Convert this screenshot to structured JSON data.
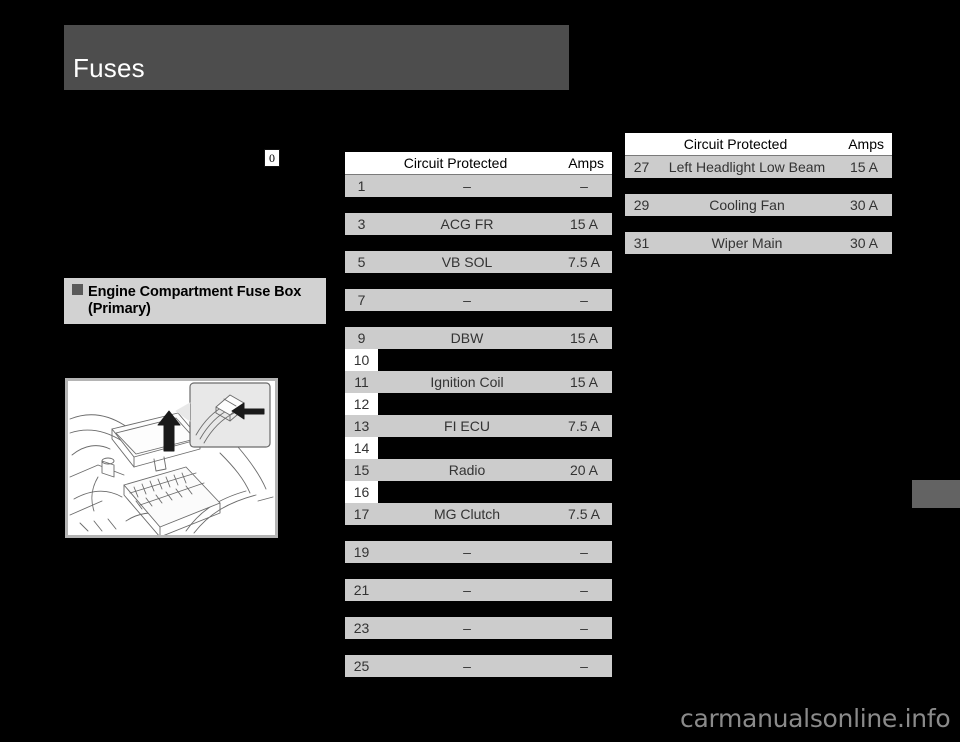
{
  "page": {
    "title": "Fuses",
    "reference_marker": "0",
    "watermark": "carmanualsonline.info"
  },
  "section": {
    "heading_line1": "Engine Compartment Fuse Box",
    "heading_line2": "(Primary)",
    "bullet_icon": "filled-square-icon"
  },
  "illustration": {
    "name": "engine-compartment-fuse-box-diagram",
    "description": "Engine bay fuse box with lid lifted, inset detail showing release tab being pressed"
  },
  "tables": {
    "primary": {
      "header": {
        "number": "",
        "circuit": "Circuit Protected",
        "amps": "Amps"
      },
      "rows": [
        {
          "number": "1",
          "circuit": "–",
          "amps": "–",
          "empty": false,
          "gap_after": "lg"
        },
        {
          "number": "3",
          "circuit": "ACG FR",
          "amps": "15 A",
          "empty": false,
          "gap_after": "lg"
        },
        {
          "number": "5",
          "circuit": "VB SOL",
          "amps": "7.5 A",
          "empty": false,
          "gap_after": "lg"
        },
        {
          "number": "7",
          "circuit": "–",
          "amps": "–",
          "empty": false,
          "gap_after": "lg"
        },
        {
          "number": "9",
          "circuit": "DBW",
          "amps": "15 A",
          "empty": false,
          "gap_after": "none"
        },
        {
          "number": "10",
          "circuit": "",
          "amps": "",
          "empty": true,
          "gap_after": "none"
        },
        {
          "number": "11",
          "circuit": "Ignition Coil",
          "amps": "15 A",
          "empty": false,
          "gap_after": "none"
        },
        {
          "number": "12",
          "circuit": "",
          "amps": "",
          "empty": true,
          "gap_after": "none"
        },
        {
          "number": "13",
          "circuit": "FI ECU",
          "amps": "7.5 A",
          "empty": false,
          "gap_after": "none"
        },
        {
          "number": "14",
          "circuit": "",
          "amps": "",
          "empty": true,
          "gap_after": "none"
        },
        {
          "number": "15",
          "circuit": "Radio",
          "amps": "20 A",
          "empty": false,
          "gap_after": "none"
        },
        {
          "number": "16",
          "circuit": "",
          "amps": "",
          "empty": true,
          "gap_after": "none"
        },
        {
          "number": "17",
          "circuit": "MG Clutch",
          "amps": "7.5 A",
          "empty": false,
          "gap_after": "lg"
        },
        {
          "number": "19",
          "circuit": "–",
          "amps": "–",
          "empty": false,
          "gap_after": "lg"
        },
        {
          "number": "21",
          "circuit": "–",
          "amps": "–",
          "empty": false,
          "gap_after": "lg"
        },
        {
          "number": "23",
          "circuit": "–",
          "amps": "–",
          "empty": false,
          "gap_after": "lg"
        },
        {
          "number": "25",
          "circuit": "–",
          "amps": "–",
          "empty": false,
          "gap_after": "none"
        }
      ]
    },
    "secondary": {
      "header": {
        "number": "",
        "circuit": "Circuit Protected",
        "amps": "Amps"
      },
      "rows": [
        {
          "number": "27",
          "circuit": "Left Headlight Low Beam",
          "amps": "15 A",
          "empty": false,
          "gap_after": "lg"
        },
        {
          "number": "29",
          "circuit": "Cooling Fan",
          "amps": "30 A",
          "empty": false,
          "gap_after": "lg"
        },
        {
          "number": "31",
          "circuit": "Wiper Main",
          "amps": "30 A",
          "empty": false,
          "gap_after": "none"
        }
      ]
    }
  },
  "index_tab": {
    "name": "page-index-tab",
    "color": "#636363"
  },
  "colors": {
    "background": "#000000",
    "title_bar": "#4d4d4d",
    "row_fill": "#cccccc",
    "header_fill": "#ffffff",
    "heading_fill": "#d2d2d2"
  }
}
